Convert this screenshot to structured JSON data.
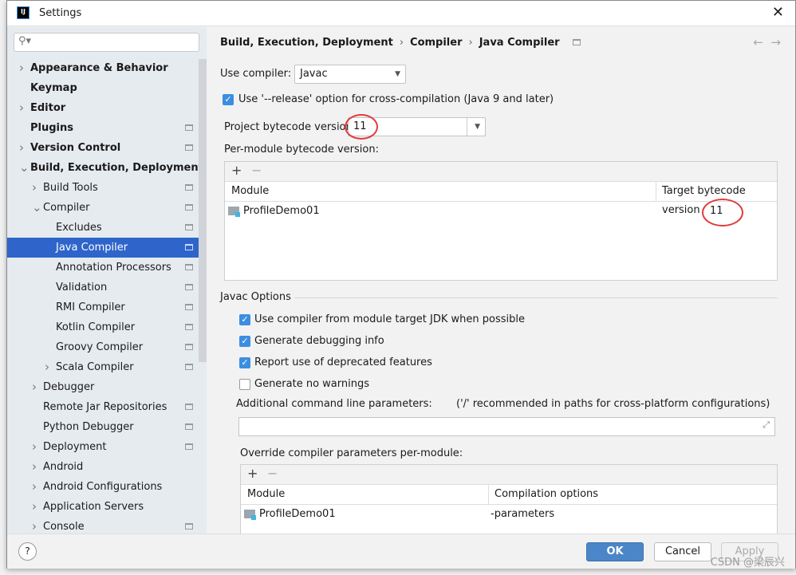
{
  "window": {
    "title": "Settings",
    "logo": "IJ"
  },
  "sidebar": {
    "search_placeholder": "",
    "items": [
      {
        "label": "Appearance & Behavior",
        "level": 0,
        "bold": true,
        "chevron": "right"
      },
      {
        "label": "Keymap",
        "level": 0,
        "bold": true
      },
      {
        "label": "Editor",
        "level": 0,
        "bold": true,
        "chevron": "right"
      },
      {
        "label": "Plugins",
        "level": 0,
        "bold": true,
        "project_icon": true
      },
      {
        "label": "Version Control",
        "level": 0,
        "bold": true,
        "chevron": "right",
        "project_icon": true
      },
      {
        "label": "Build, Execution, Deployment",
        "level": 0,
        "bold": true,
        "chevron": "down"
      },
      {
        "label": "Build Tools",
        "level": 1,
        "chevron": "right",
        "project_icon": true
      },
      {
        "label": "Compiler",
        "level": 1,
        "chevron": "down",
        "project_icon": true
      },
      {
        "label": "Excludes",
        "level": 2,
        "project_icon": true
      },
      {
        "label": "Java Compiler",
        "level": 2,
        "selected": true,
        "project_icon": true
      },
      {
        "label": "Annotation Processors",
        "level": 2,
        "project_icon": true
      },
      {
        "label": "Validation",
        "level": 2,
        "project_icon": true
      },
      {
        "label": "RMI Compiler",
        "level": 2,
        "project_icon": true
      },
      {
        "label": "Kotlin Compiler",
        "level": 2,
        "project_icon": true
      },
      {
        "label": "Groovy Compiler",
        "level": 2,
        "project_icon": true
      },
      {
        "label": "Scala Compiler",
        "level": 2,
        "chevron": "right",
        "project_icon": true
      },
      {
        "label": "Debugger",
        "level": 1,
        "chevron": "right"
      },
      {
        "label": "Remote Jar Repositories",
        "level": 1,
        "project_icon": true
      },
      {
        "label": "Python Debugger",
        "level": 1,
        "project_icon": true
      },
      {
        "label": "Deployment",
        "level": 1,
        "chevron": "right",
        "project_icon": true
      },
      {
        "label": "Android",
        "level": 1,
        "chevron": "right"
      },
      {
        "label": "Android Configurations",
        "level": 1,
        "chevron": "right"
      },
      {
        "label": "Application Servers",
        "level": 1,
        "chevron": "right"
      },
      {
        "label": "Console",
        "level": 1,
        "chevron": "right",
        "project_icon": true
      }
    ]
  },
  "breadcrumb": [
    "Build, Execution, Deployment",
    "Compiler",
    "Java Compiler"
  ],
  "main": {
    "use_compiler_label": "Use compiler:",
    "use_compiler_value": "Javac",
    "release_option": "Use '--release' option for cross-compilation (Java 9 and later)",
    "project_bytecode_label": "Project bytecode version:",
    "project_bytecode_value": "11",
    "per_module_label": "Per-module bytecode version:",
    "per_module_table": {
      "columns": [
        "Module",
        "Target bytecode version"
      ],
      "rows": [
        {
          "module": "ProfileDemo01",
          "version": "11"
        }
      ]
    },
    "javac_options_label": "Javac Options",
    "options": [
      {
        "label": "Use compiler from module target JDK when possible",
        "checked": true
      },
      {
        "label": "Generate debugging info",
        "checked": true
      },
      {
        "label": "Report use of deprecated features",
        "checked": true
      },
      {
        "label": "Generate no warnings",
        "checked": false
      }
    ],
    "additional_params_label": "Additional command line parameters:",
    "additional_params_hint": "('/' recommended in paths for cross-platform configurations)",
    "additional_params_value": "",
    "override_label": "Override compiler parameters per-module:",
    "override_table": {
      "columns": [
        "Module",
        "Compilation options"
      ],
      "rows": [
        {
          "module": "ProfileDemo01",
          "options": "-parameters"
        }
      ]
    }
  },
  "buttons": {
    "help": "?",
    "ok": "OK",
    "cancel": "Cancel",
    "apply": "Apply"
  },
  "watermark": "CSDN @梁辰兴",
  "colors": {
    "selection": "#2f65ca",
    "ok": "#4a86c8",
    "checkbox": "#3c8ee0",
    "annotation_circle": "#e23b3b"
  }
}
